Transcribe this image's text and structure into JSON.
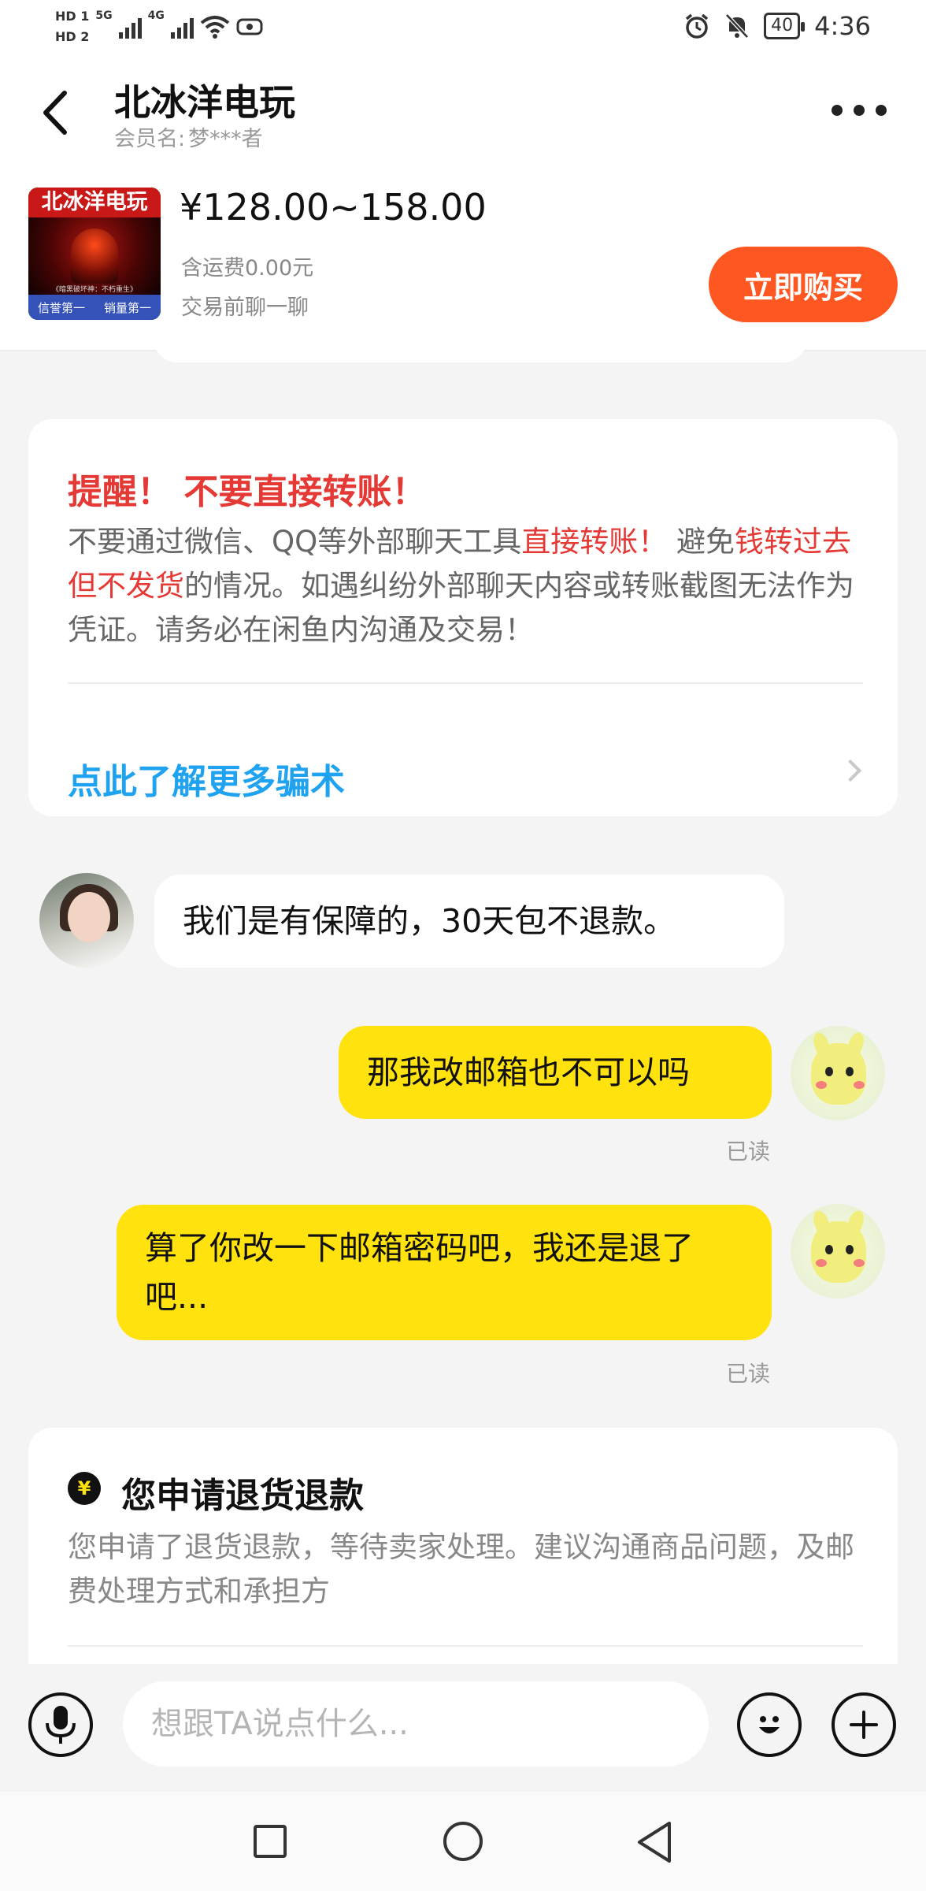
{
  "status_bar": {
    "hd1": "HD 1",
    "hd2": "HD 2",
    "net1": "5G",
    "net2": "4G",
    "battery": "40",
    "time": "4:36"
  },
  "header": {
    "title": "北冰洋电玩",
    "member_label": "会员名:",
    "member_name": "梦***者"
  },
  "product": {
    "thumb_title": "北冰洋电玩",
    "thumb_caption": "《暗黑破坏神：不朽重生》",
    "thumb_badge_left": "信誉第一",
    "thumb_badge_right": "销量第一",
    "price": "¥128.00~158.00",
    "shipping": "含运费0.00元",
    "chat_note": "交易前聊一聊",
    "buy_label": "立即购买"
  },
  "warning": {
    "title": "提醒！ 不要直接转账！",
    "body_1": "不要通过微信、QQ等外部聊天工具",
    "body_red_1": "直接转账！",
    "body_2": " 避免",
    "body_red_2": "钱转过去但不发货",
    "body_3": "的情况。如遇纠纷外部聊天内容或转账截图无法作为凭证。请务必在闲鱼内沟通及交易！",
    "link": "点此了解更多骗术"
  },
  "messages": [
    {
      "from": "seller",
      "text": "我们是有保障的，30天包不退款。"
    },
    {
      "from": "me",
      "text": "那我改邮箱也不可以吗",
      "status": "已读"
    },
    {
      "from": "me",
      "text": "算了你改一下邮箱密码吧，我还是退了吧...",
      "status": "已读"
    }
  ],
  "refund": {
    "icon": "¥",
    "title": "您申请退货退款",
    "body": "您申请了退货退款，等待卖家处理。建议沟通商品问题，及邮费处理方式和承担方"
  },
  "input": {
    "placeholder": "想跟TA说点什么..."
  },
  "icons": {
    "back": "back-arrow-icon",
    "more": "more-dots-icon",
    "mic": "microphone-icon",
    "emoji": "emoji-icon",
    "plus": "plus-icon",
    "refund": "yuan-coin-icon"
  },
  "colors": {
    "accent_orange": "#ff5722",
    "my_bubble": "#ffe20e",
    "warning_red": "#e53935",
    "link_blue": "#1fa3f0"
  }
}
